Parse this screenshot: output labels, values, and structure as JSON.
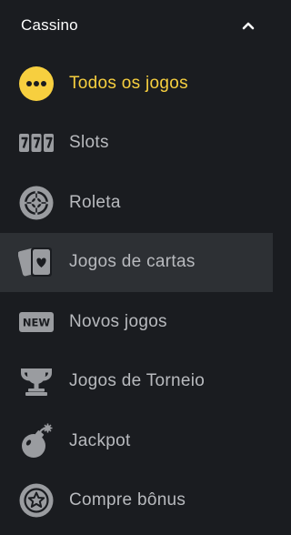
{
  "header": {
    "title": "Cassino",
    "toggle_icon": "chevron-up-icon"
  },
  "colors": {
    "background": "#1a1c20",
    "hover_background": "#2d3034",
    "accent": "#f7cf3f",
    "text": "#b8babe",
    "icon": "#9a9ca0"
  },
  "menu": {
    "items": [
      {
        "label": "Todos os jogos",
        "icon": "more-dots-icon",
        "active": true
      },
      {
        "label": "Slots",
        "icon": "slot-machine-icon"
      },
      {
        "label": "Roleta",
        "icon": "roulette-icon"
      },
      {
        "label": "Jogos de cartas",
        "icon": "playing-cards-icon",
        "highlighted": true
      },
      {
        "label": "Novos jogos",
        "icon": "new-badge-icon",
        "badge_text": "NEW"
      },
      {
        "label": "Jogos de Torneio",
        "icon": "trophy-icon"
      },
      {
        "label": "Jackpot",
        "icon": "bomb-icon"
      },
      {
        "label": "Compre bônus",
        "icon": "star-coin-icon"
      }
    ]
  }
}
